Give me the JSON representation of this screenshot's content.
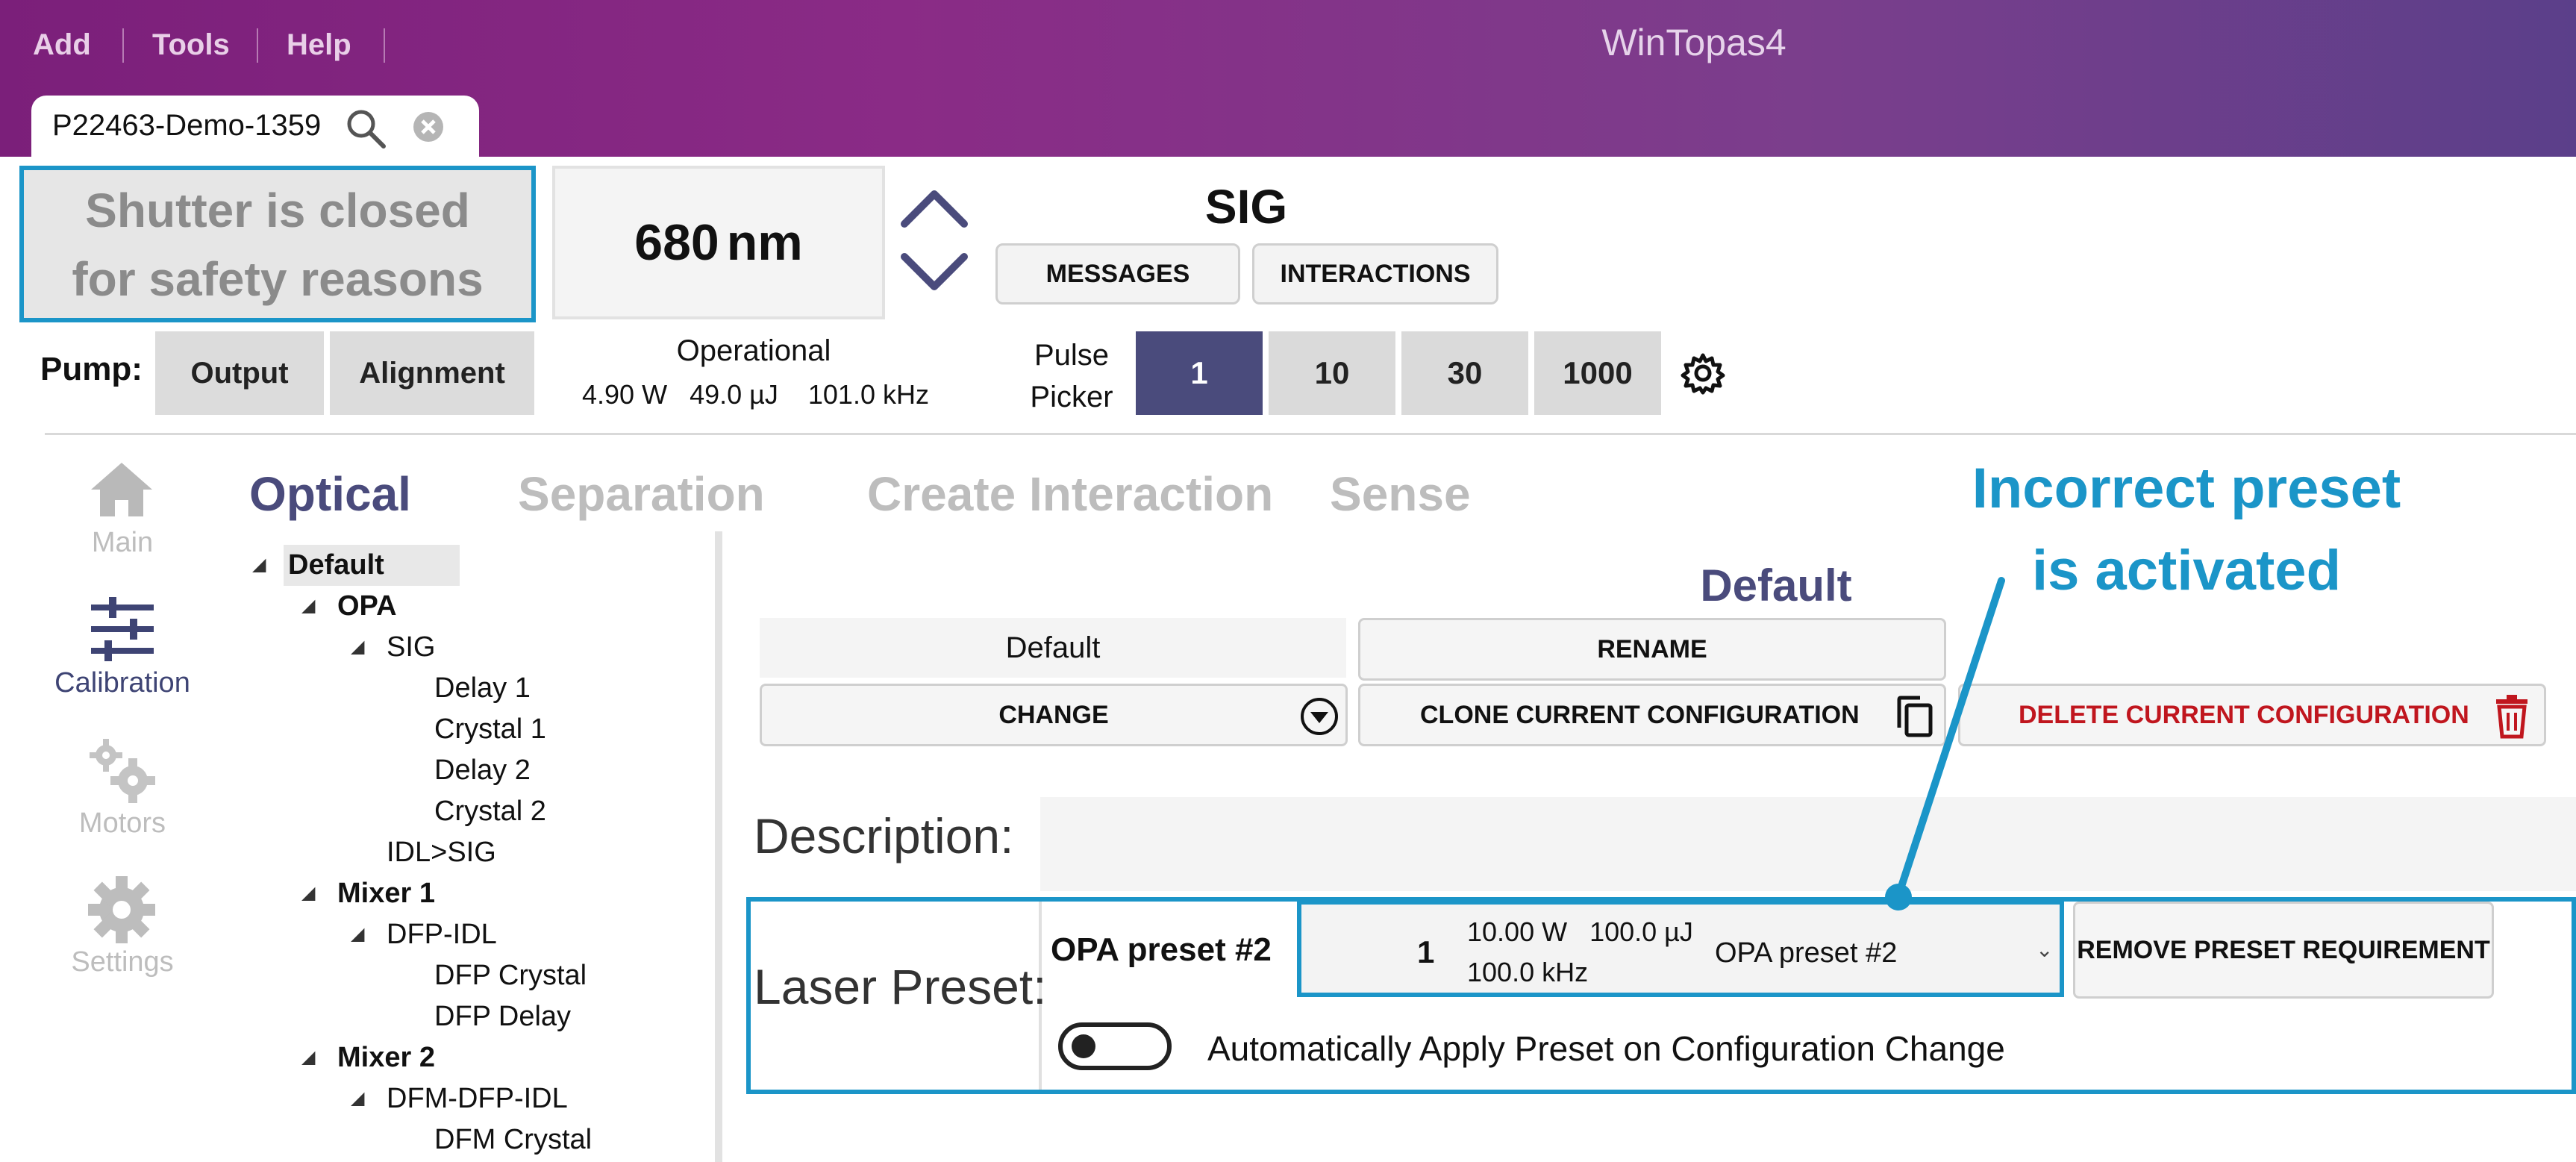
{
  "app": {
    "title": "WinTopas4"
  },
  "menu": [
    {
      "label": "Add"
    },
    {
      "label": "Tools"
    },
    {
      "label": "Help"
    }
  ],
  "tab": {
    "label": "P22463-Demo-1359"
  },
  "shutter": {
    "line1": "Shutter is closed",
    "line2": "for safety reasons"
  },
  "wavelength": {
    "value": "680",
    "unit": "nm"
  },
  "signal": {
    "name": "SIG",
    "messages_label": "MESSAGES",
    "interactions_label": "INTERACTIONS"
  },
  "pump": {
    "label": "Pump:",
    "output_label": "Output",
    "alignment_label": "Alignment",
    "status": "Operational",
    "power": "4.90 W",
    "energy": "49.0 µJ",
    "frequency": "101.0 kHz"
  },
  "pulse_picker": {
    "label_line1": "Pulse",
    "label_line2": "Picker",
    "options": [
      {
        "label": "1"
      },
      {
        "label": "10"
      },
      {
        "label": "30"
      },
      {
        "label": "1000"
      }
    ],
    "selected": "1"
  },
  "nav": [
    {
      "label": "Main",
      "icon": "home-icon"
    },
    {
      "label": "Calibration",
      "icon": "sliders-icon"
    },
    {
      "label": "Motors",
      "icon": "gears-icon"
    },
    {
      "label": "Settings",
      "icon": "gear-icon"
    }
  ],
  "sections": [
    {
      "label": "Optical"
    },
    {
      "label": "Separation"
    },
    {
      "label": "Create Interaction"
    },
    {
      "label": "Sense"
    }
  ],
  "tree": [
    {
      "label": "Default"
    },
    {
      "label": "OPA"
    },
    {
      "label": "SIG"
    },
    {
      "label": "Delay 1"
    },
    {
      "label": "Crystal 1"
    },
    {
      "label": "Delay 2"
    },
    {
      "label": "Crystal 2"
    },
    {
      "label": "IDL>SIG"
    },
    {
      "label": "Mixer 1"
    },
    {
      "label": "DFP-IDL"
    },
    {
      "label": "DFP Crystal"
    },
    {
      "label": "DFP Delay"
    },
    {
      "label": "Mixer 2"
    },
    {
      "label": "DFM-DFP-IDL"
    },
    {
      "label": "DFM Crystal"
    }
  ],
  "config": {
    "heading": "Default",
    "name_value": "Default",
    "rename_label": "RENAME",
    "change_label": "CHANGE",
    "clone_label": "CLONE CURRENT CONFIGURATION",
    "delete_label": "DELETE CURRENT CONFIGURATION",
    "description_label": "Description:",
    "laser_preset_label": "Laser Preset:",
    "preset_name": "OPA preset #2",
    "preset_select": {
      "number": "1",
      "power": "10.00 W",
      "energy": "100.0 µJ",
      "frequency": "100.0 kHz",
      "name": "OPA preset #2"
    },
    "remove_preset_label": "REMOVE PRESET REQUIREMENT",
    "auto_apply_label": "Automatically Apply Preset on Configuration Change",
    "auto_apply_on": false
  },
  "annotation": {
    "line1": "Incorrect preset",
    "line2": "is activated"
  },
  "colors": {
    "accent": "#1b95c8",
    "selected": "#4a4b7c",
    "danger": "#c0161e",
    "titlebar_start": "#7b1f7a",
    "titlebar_end": "#5b3f8a"
  }
}
